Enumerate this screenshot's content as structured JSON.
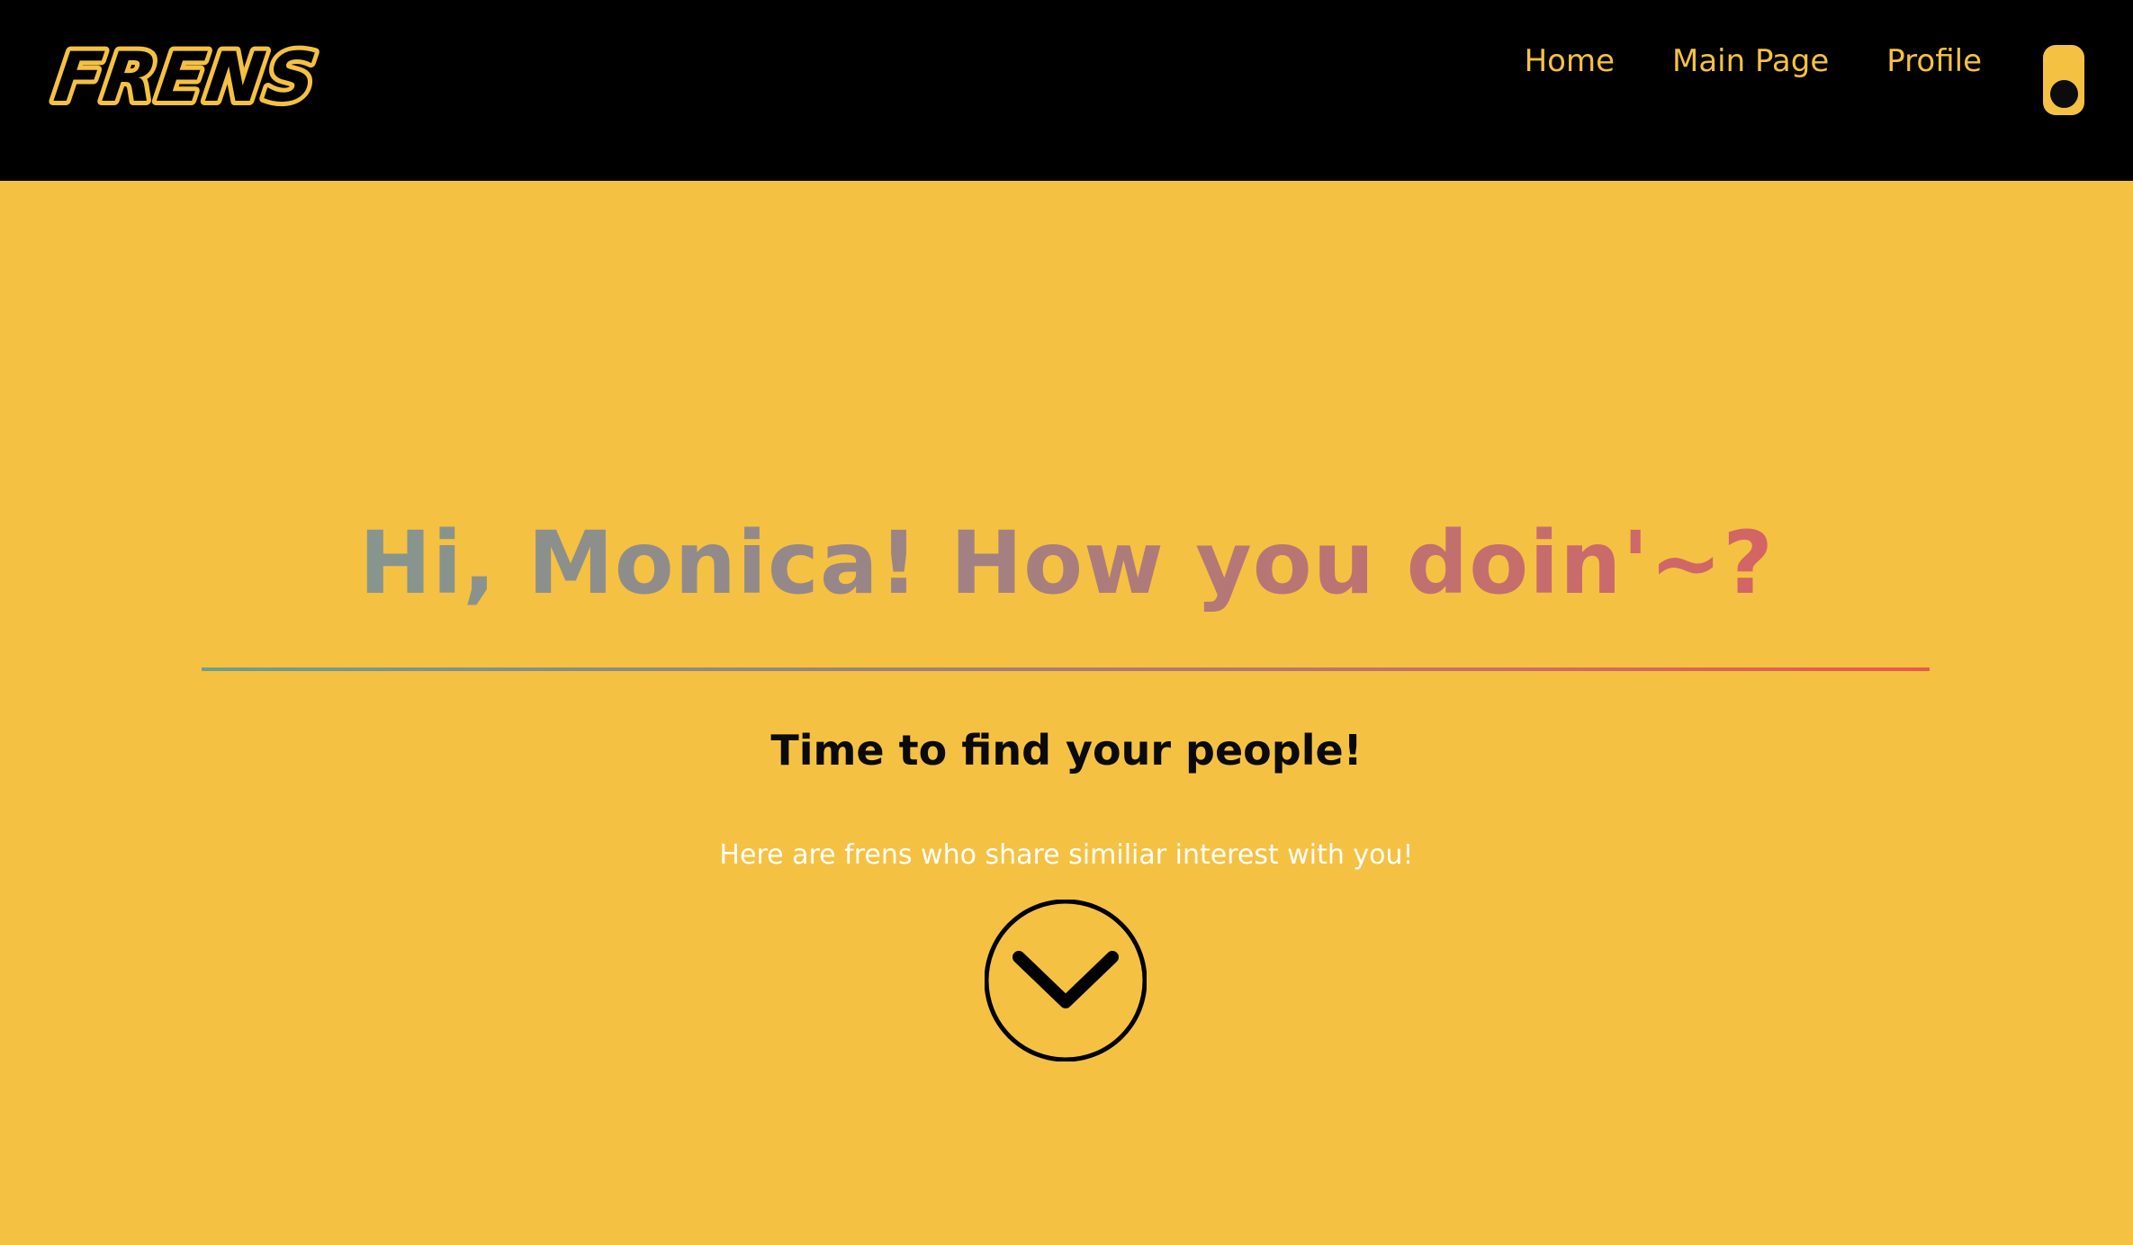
{
  "navbar": {
    "logo_text": "FRENS",
    "links": [
      {
        "label": "Home"
      },
      {
        "label": "Main Page"
      },
      {
        "label": "Profile"
      }
    ]
  },
  "hero": {
    "title": "Hi, Monica! How you doin'~?",
    "subtitle": "Time to find your people!",
    "description": "Here are frens who share similiar interest with you!"
  },
  "colors": {
    "background": "#F5C142",
    "navbar": "#000000",
    "nav_link": "#F5C142",
    "title_gradient_start": "#86968E",
    "title_gradient_end": "#D46464",
    "description": "#FFFFFF"
  },
  "icons": {
    "scroll": "chevron-down-circle-icon",
    "theme_toggle": "toggle-switch-icon"
  }
}
